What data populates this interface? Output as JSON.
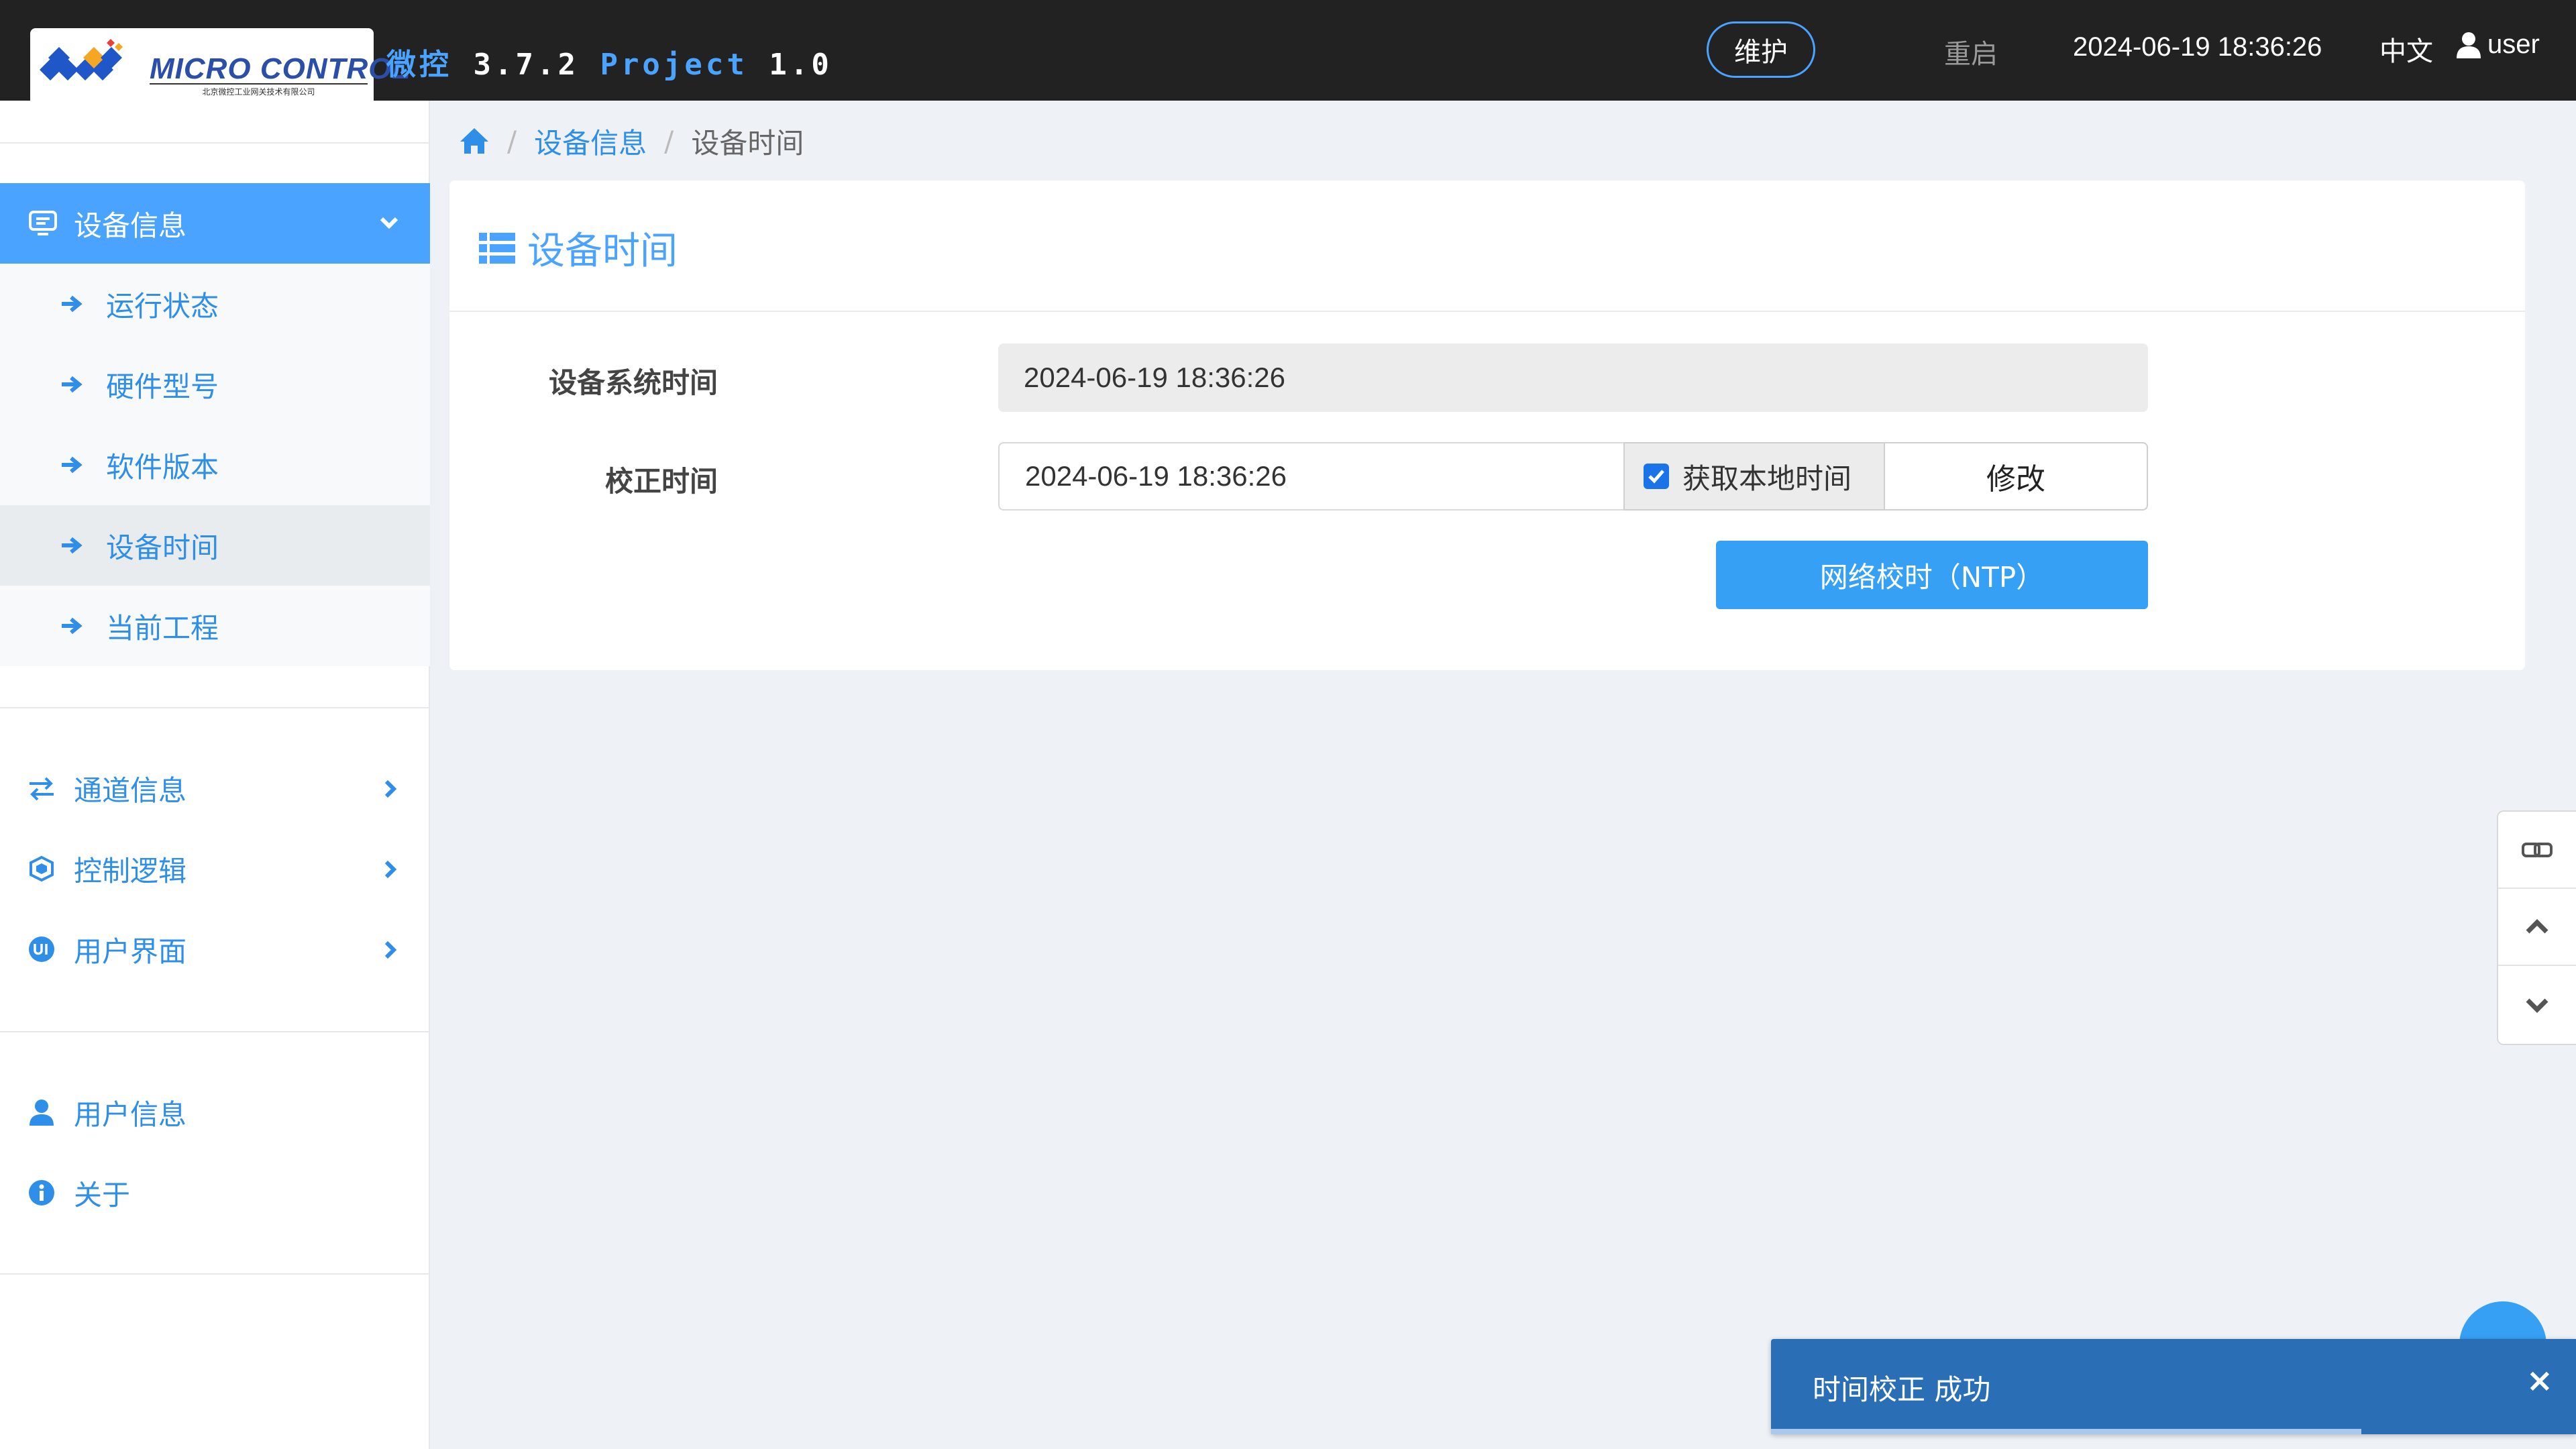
{
  "header": {
    "logo_brand": "MICRO CONTROL",
    "logo_sub": "北京微控工业网关技术有限公司",
    "app_name": "微控",
    "app_version": "3.7.2",
    "project_label": "Project",
    "project_version": "1.0",
    "maintenance_label": "维护",
    "restart_label": "重启",
    "clock": "2024-06-19 18:36:26",
    "language": "中文",
    "user": "user"
  },
  "sidebar": {
    "active_group": "设备信息",
    "sub_items": [
      {
        "label": "运行状态"
      },
      {
        "label": "硬件型号"
      },
      {
        "label": "软件版本"
      },
      {
        "label": "设备时间"
      },
      {
        "label": "当前工程"
      }
    ],
    "groups": [
      {
        "label": "通道信息",
        "icon": "swap-icon"
      },
      {
        "label": "控制逻辑",
        "icon": "cube-icon"
      },
      {
        "label": "用户界面",
        "icon": "ui-icon"
      }
    ],
    "bottom": [
      {
        "label": "用户信息",
        "icon": "user-icon"
      },
      {
        "label": "关于",
        "icon": "info-icon"
      }
    ]
  },
  "breadcrumb": {
    "home_icon": "home-icon",
    "level1": "设备信息",
    "current": "设备时间"
  },
  "panel": {
    "title": "设备时间",
    "system_time_label": "设备系统时间",
    "system_time_value": "2024-06-19 18:36:26",
    "correct_time_label": "校正时间",
    "correct_time_value": "2024-06-19 18:36:26",
    "local_time_checkbox_label": "获取本地时间",
    "local_time_checked": true,
    "modify_label": "修改",
    "ntp_label": "网络校时（NTP）"
  },
  "toast": {
    "message": "时间校正 成功",
    "close": "×"
  },
  "colors": {
    "accent": "#4aa3ff",
    "topbar": "#222222",
    "toast": "#2a6fb5"
  }
}
